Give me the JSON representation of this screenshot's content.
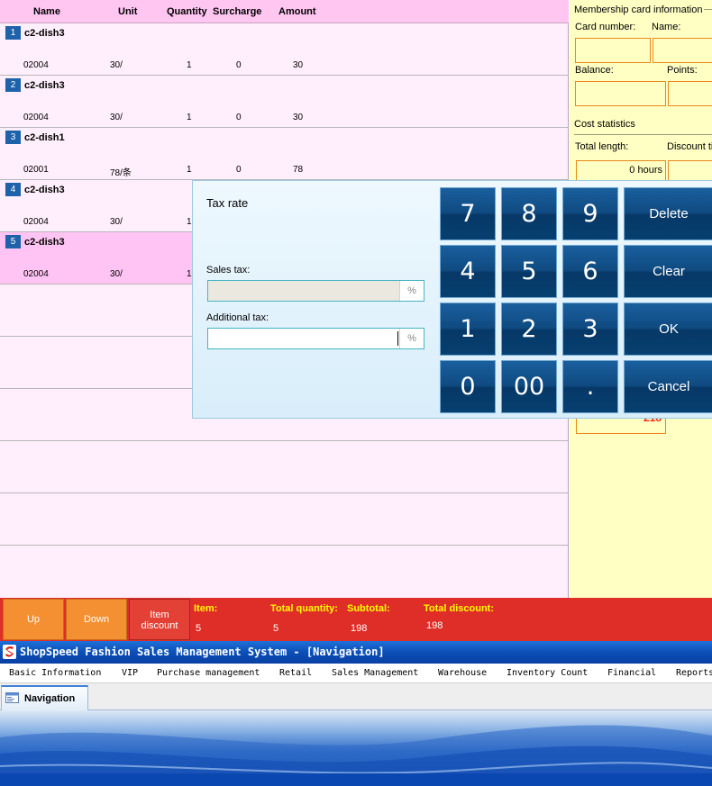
{
  "order": {
    "columns": {
      "name": "Name",
      "unit": "Unit",
      "quantity": "Quantity",
      "surcharge": "Surcharge",
      "amount": "Amount"
    },
    "rows": [
      {
        "index": "1",
        "name": "c2-dish3",
        "code": "02004",
        "unit": "30/",
        "quantity": "1",
        "surcharge": "0",
        "amount": "30",
        "selected": false
      },
      {
        "index": "2",
        "name": "c2-dish3",
        "code": "02004",
        "unit": "30/",
        "quantity": "1",
        "surcharge": "0",
        "amount": "30",
        "selected": false
      },
      {
        "index": "3",
        "name": "c2-dish1",
        "code": "02001",
        "unit": "78/条",
        "quantity": "1",
        "surcharge": "0",
        "amount": "78",
        "selected": false
      },
      {
        "index": "4",
        "name": "c2-dish3",
        "code": "02004",
        "unit": "30/",
        "quantity": "1",
        "surcharge": "",
        "amount": "",
        "selected": false
      },
      {
        "index": "5",
        "name": "c2-dish3",
        "code": "02004",
        "unit": "30/",
        "quantity": "1",
        "surcharge": "",
        "amount": "",
        "selected": true
      }
    ]
  },
  "member": {
    "title": "Membership card information",
    "card_number_label": "Card number:",
    "name_label": "Name:",
    "balance_label": "Balance:",
    "points_label": "Points:",
    "cost_statistics_label": "Cost statistics",
    "total_length_label": "Total length:",
    "discount_time_label": "Discount ti",
    "total_length_value": "0 hours",
    "partial_value": "218"
  },
  "tax_popup": {
    "title": "Tax rate",
    "sales_tax_label": "Sales tax:",
    "sales_tax_value": "",
    "additional_tax_label": "Additional tax:",
    "additional_tax_value": "",
    "percent_symbol": "%",
    "keys": [
      "7",
      "8",
      "9",
      "4",
      "5",
      "6",
      "1",
      "2",
      "3",
      "0",
      "00",
      "."
    ],
    "delete_label": "Delete",
    "clear_label": "Clear",
    "ok_label": "OK",
    "cancel_label": "Cancel"
  },
  "action_bar": {
    "up_label": "Up",
    "down_label": "Down",
    "item_discount_label_1": "Item",
    "item_discount_label_2": "discount",
    "item_label": "Item:",
    "item_value": "5",
    "total_quantity_label": "Total quantity:",
    "total_quantity_value": "5",
    "subtotal_label": "Subtotal:",
    "subtotal_value": "198",
    "total_discount_label": "Total discount:",
    "total_discount_value": "198"
  },
  "window": {
    "title": "ShopSpeed Fashion Sales Management System - [Navigation]",
    "menu": [
      "Basic Information",
      "VIP",
      "Purchase management",
      "Retail",
      "Sales Management",
      "Warehouse",
      "Inventory Count",
      "Financial",
      "Reports"
    ],
    "active_tab": "Navigation"
  },
  "colors": {
    "header_pink": "#ffc6f2",
    "row_pink": "#ffeefb",
    "member_yellow": "#ffffc4",
    "key_blue": "#0f4a80",
    "action_red": "#df2d28",
    "action_orange": "#f49032",
    "label_yellow": "#ffff00",
    "title_blue": "#0b4fb7"
  }
}
